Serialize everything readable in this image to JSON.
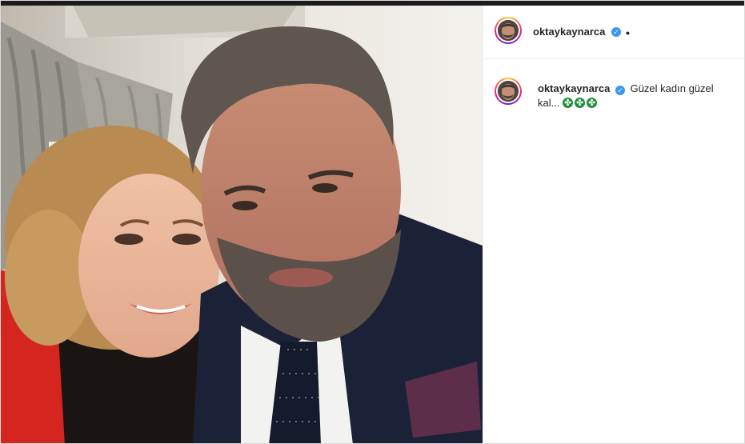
{
  "post": {
    "username": "oktaykaynarca",
    "verified_icon": "verified-badge-icon",
    "more_indicator": "•",
    "caption_username": "oktaykaynarca",
    "caption_text": "Güzel kadın güzel kal...",
    "caption_emojis": [
      "four-leaf-clover-icon",
      "four-leaf-clover-icon",
      "four-leaf-clover-icon"
    ],
    "photo_icon": "selfie-photo"
  },
  "colors": {
    "verified": "#3897f0",
    "text": "#262626",
    "border": "#dbdbdb",
    "clover": "#1f8f3a"
  }
}
